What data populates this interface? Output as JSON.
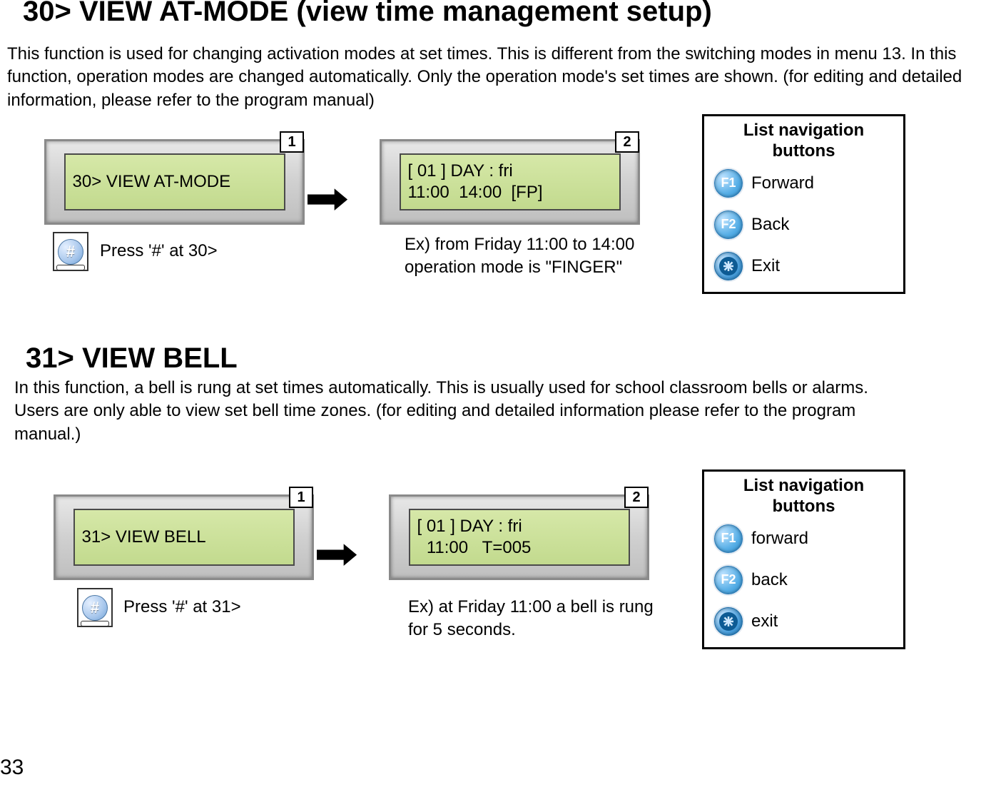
{
  "page_number": "33",
  "section30": {
    "heading": "30> VIEW AT-MODE (view time management setup)",
    "description": " This function is used for changing activation modes at set times. This is different from the switching modes in menu 13. In this function, operation modes are changed automatically. Only the operation mode's set times are shown. (for editing and detailed information, please refer to the program manual)",
    "screen1": {
      "step": "1",
      "line1": "30> VIEW AT-MODE"
    },
    "press_text": "Press '#' at 30>",
    "screen2": {
      "step": "2",
      "line1": "[ 01 ] DAY : fri",
      "line2": "11:00  14:00  [FP]"
    },
    "example": "Ex) from Friday 11:00 to 14:00\noperation mode is \"FINGER\"",
    "nav": {
      "title": "List navigation buttons",
      "f1_key": "F1",
      "f1_label": "Forward",
      "f2_key": "F2",
      "f2_label": "Back",
      "exit_label": "Exit"
    }
  },
  "section31": {
    "heading": "31> VIEW BELL",
    "description": "In this function, a bell is rung at set times automatically. This is usually used for school classroom bells or alarms. Users are only able to view set bell time zones. (for editing and detailed information please refer to the program manual.)",
    "screen1": {
      "step": "1",
      "line1": "31> VIEW BELL"
    },
    "press_text": "Press '#' at 31>",
    "screen2": {
      "step": "2",
      "line1": "[ 01 ] DAY : fri",
      "line2": "  11:00   T=005"
    },
    "example": "Ex) at Friday 11:00 a bell is rung\nfor 5 seconds.",
    "nav": {
      "title": "List navigation buttons",
      "f1_key": "F1",
      "f1_label": "forward",
      "f2_key": "F2",
      "f2_label": "back",
      "exit_label": "exit"
    }
  }
}
